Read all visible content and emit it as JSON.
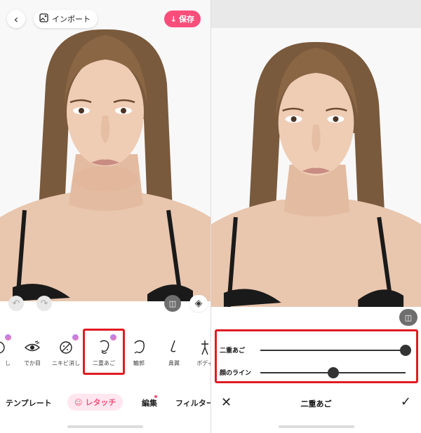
{
  "left": {
    "import_label": "インポート",
    "save_label": "保存",
    "tools": [
      {
        "label": "し",
        "icon": "partial-tool-icon",
        "gem": true
      },
      {
        "label": "でか目",
        "icon": "big-eye-icon",
        "gem": false
      },
      {
        "label": "ニキビ消し",
        "icon": "acne-removal-icon",
        "gem": true
      },
      {
        "label": "二重あご",
        "icon": "double-chin-icon",
        "gem": true
      },
      {
        "label": "輪郭",
        "icon": "face-contour-icon",
        "gem": false
      },
      {
        "label": "鼻翼",
        "icon": "nose-icon",
        "gem": false
      },
      {
        "label": "ボディ",
        "icon": "body-icon",
        "gem": false
      }
    ],
    "nav": {
      "template": "テンプレート",
      "retouch": "レタッチ",
      "edit": "編集",
      "filter": "フィルター"
    }
  },
  "right": {
    "sliders": [
      {
        "label": "二重あご",
        "value": 1.0
      },
      {
        "label": "顔のライン",
        "value": 0.5
      }
    ],
    "title": "二重あご"
  },
  "colors": {
    "accent": "#fa4e7a",
    "highlight": "#e11b22"
  }
}
